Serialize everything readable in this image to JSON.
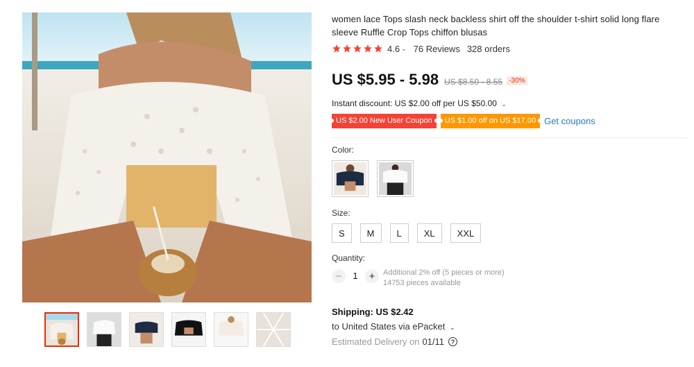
{
  "product": {
    "title": "women lace Tops slash neck backless shirt off the shoulder t-shirt solid long flare sleeve Ruffle Crop Tops chiffon blusas",
    "rating": "4.6",
    "reviews": "76 Reviews",
    "orders": "328 orders",
    "price": "US $5.95 - 5.98",
    "old_price": "US $8.50 - 8.55",
    "discount": "-30%"
  },
  "promo": {
    "instant_discount": "Instant discount: US $2.00 off per US $50.00",
    "coupons": [
      "US $2.00 New User Coupon",
      "US $1.00 off on US $17.00"
    ],
    "get_coupons": "Get coupons"
  },
  "options": {
    "color_label": "Color:",
    "size_label": "Size:",
    "sizes": [
      "S",
      "M",
      "L",
      "XL",
      "XXL"
    ]
  },
  "quantity": {
    "label": "Quantity:",
    "minus": "−",
    "value": "1",
    "plus": "+",
    "note_1": "Additional 2% off (5 pieces or more)",
    "note_2": "14753 pieces available"
  },
  "shipping": {
    "cost": "Shipping: US $2.42",
    "to": "to United States via ePacket",
    "eta_label": "Estimated Delivery on",
    "eta_date": "01/11"
  },
  "icons": {
    "star": "star-icon",
    "chevron": "chevron-down-icon",
    "help": "question-circle-icon"
  },
  "colors": {
    "star": "#f44336",
    "price": "#111111",
    "coupon_red": "#f44336",
    "coupon_orange": "#ff9800",
    "link": "#2b7ac6",
    "active_thumb": "#e62e04"
  }
}
